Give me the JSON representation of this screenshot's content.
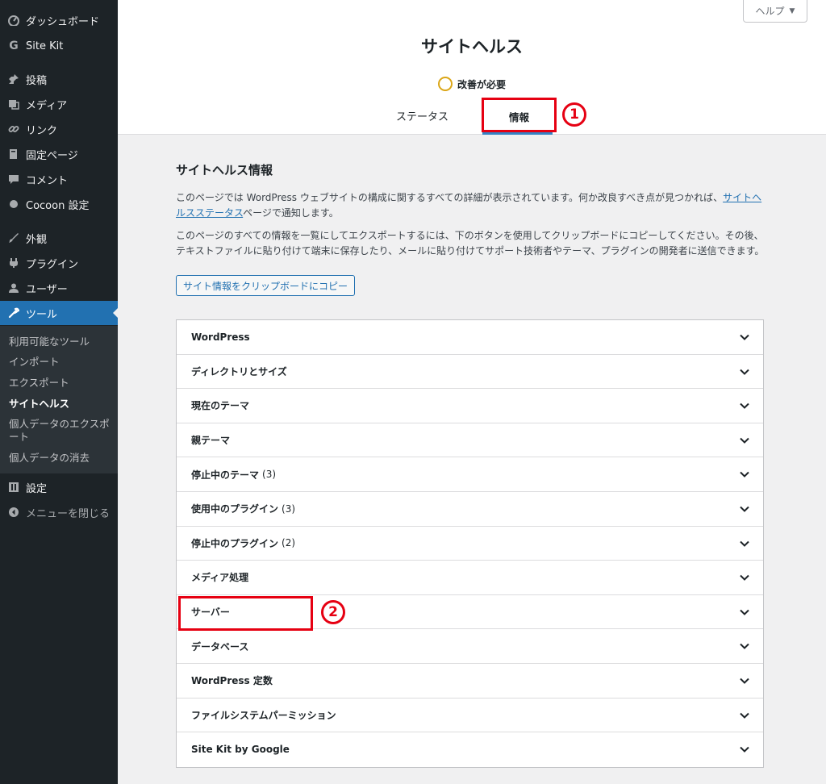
{
  "sidebar": {
    "items": [
      {
        "label": "ダッシュボード",
        "icon": "dashboard-icon"
      },
      {
        "label": "Site Kit",
        "icon": "google-g-icon"
      },
      {
        "label": "投稿",
        "icon": "pin-icon"
      },
      {
        "label": "メディア",
        "icon": "media-icon"
      },
      {
        "label": "リンク",
        "icon": "link-icon"
      },
      {
        "label": "固定ページ",
        "icon": "page-icon"
      },
      {
        "label": "コメント",
        "icon": "comment-icon"
      },
      {
        "label": "Cocoon 設定",
        "icon": "circle-icon"
      },
      {
        "label": "外観",
        "icon": "brush-icon"
      },
      {
        "label": "プラグイン",
        "icon": "plugin-icon"
      },
      {
        "label": "ユーザー",
        "icon": "user-icon"
      },
      {
        "label": "ツール",
        "icon": "wrench-icon"
      },
      {
        "label": "設定",
        "icon": "settings-icon"
      },
      {
        "label": "メニューを閉じる",
        "icon": "collapse-icon"
      }
    ],
    "submenu": [
      "利用可能なツール",
      "インポート",
      "エクスポート",
      "サイトヘルス",
      "個人データのエクスポート",
      "個人データの消去"
    ]
  },
  "header": {
    "help": "ヘルプ",
    "title": "サイトヘルス",
    "status": "改善が必要",
    "tabs": [
      "ステータス",
      "情報"
    ]
  },
  "annotations": [
    "1",
    "2"
  ],
  "main": {
    "section_title": "サイトヘルス情報",
    "para1_pre": "このページでは WordPress ウェブサイトの構成に関するすべての詳細が表示されています。何か改良すべき点が見つかれば、",
    "para1_link": "サイトヘルスステータス",
    "para1_post": "ページで通知します。",
    "para2": "このページのすべての情報を一覧にしてエクスポートするには、下のボタンを使用してクリップボードにコピーしてください。その後、テキストファイルに貼り付けて端末に保存したり、メールに貼り付けてサポート技術者やテーマ、プラグインの開発者に送信できます。",
    "copy_button": "サイト情報をクリップボードにコピー",
    "sections": [
      {
        "label": "WordPress",
        "count": ""
      },
      {
        "label": "ディレクトリとサイズ",
        "count": ""
      },
      {
        "label": "現在のテーマ",
        "count": ""
      },
      {
        "label": "親テーマ",
        "count": ""
      },
      {
        "label": "停止中のテーマ",
        "count": "(3)"
      },
      {
        "label": "使用中のプラグイン",
        "count": "(3)"
      },
      {
        "label": "停止中のプラグイン",
        "count": "(2)"
      },
      {
        "label": "メディア処理",
        "count": ""
      },
      {
        "label": "サーバー",
        "count": ""
      },
      {
        "label": "データベース",
        "count": ""
      },
      {
        "label": "WordPress 定数",
        "count": ""
      },
      {
        "label": "ファイルシステムパーミッション",
        "count": ""
      },
      {
        "label": "Site Kit by Google",
        "count": ""
      }
    ]
  },
  "colors": {
    "sidebar_bg": "#1d2327",
    "accent": "#2271b1",
    "annotation": "#e60012",
    "warning": "#dba617"
  }
}
